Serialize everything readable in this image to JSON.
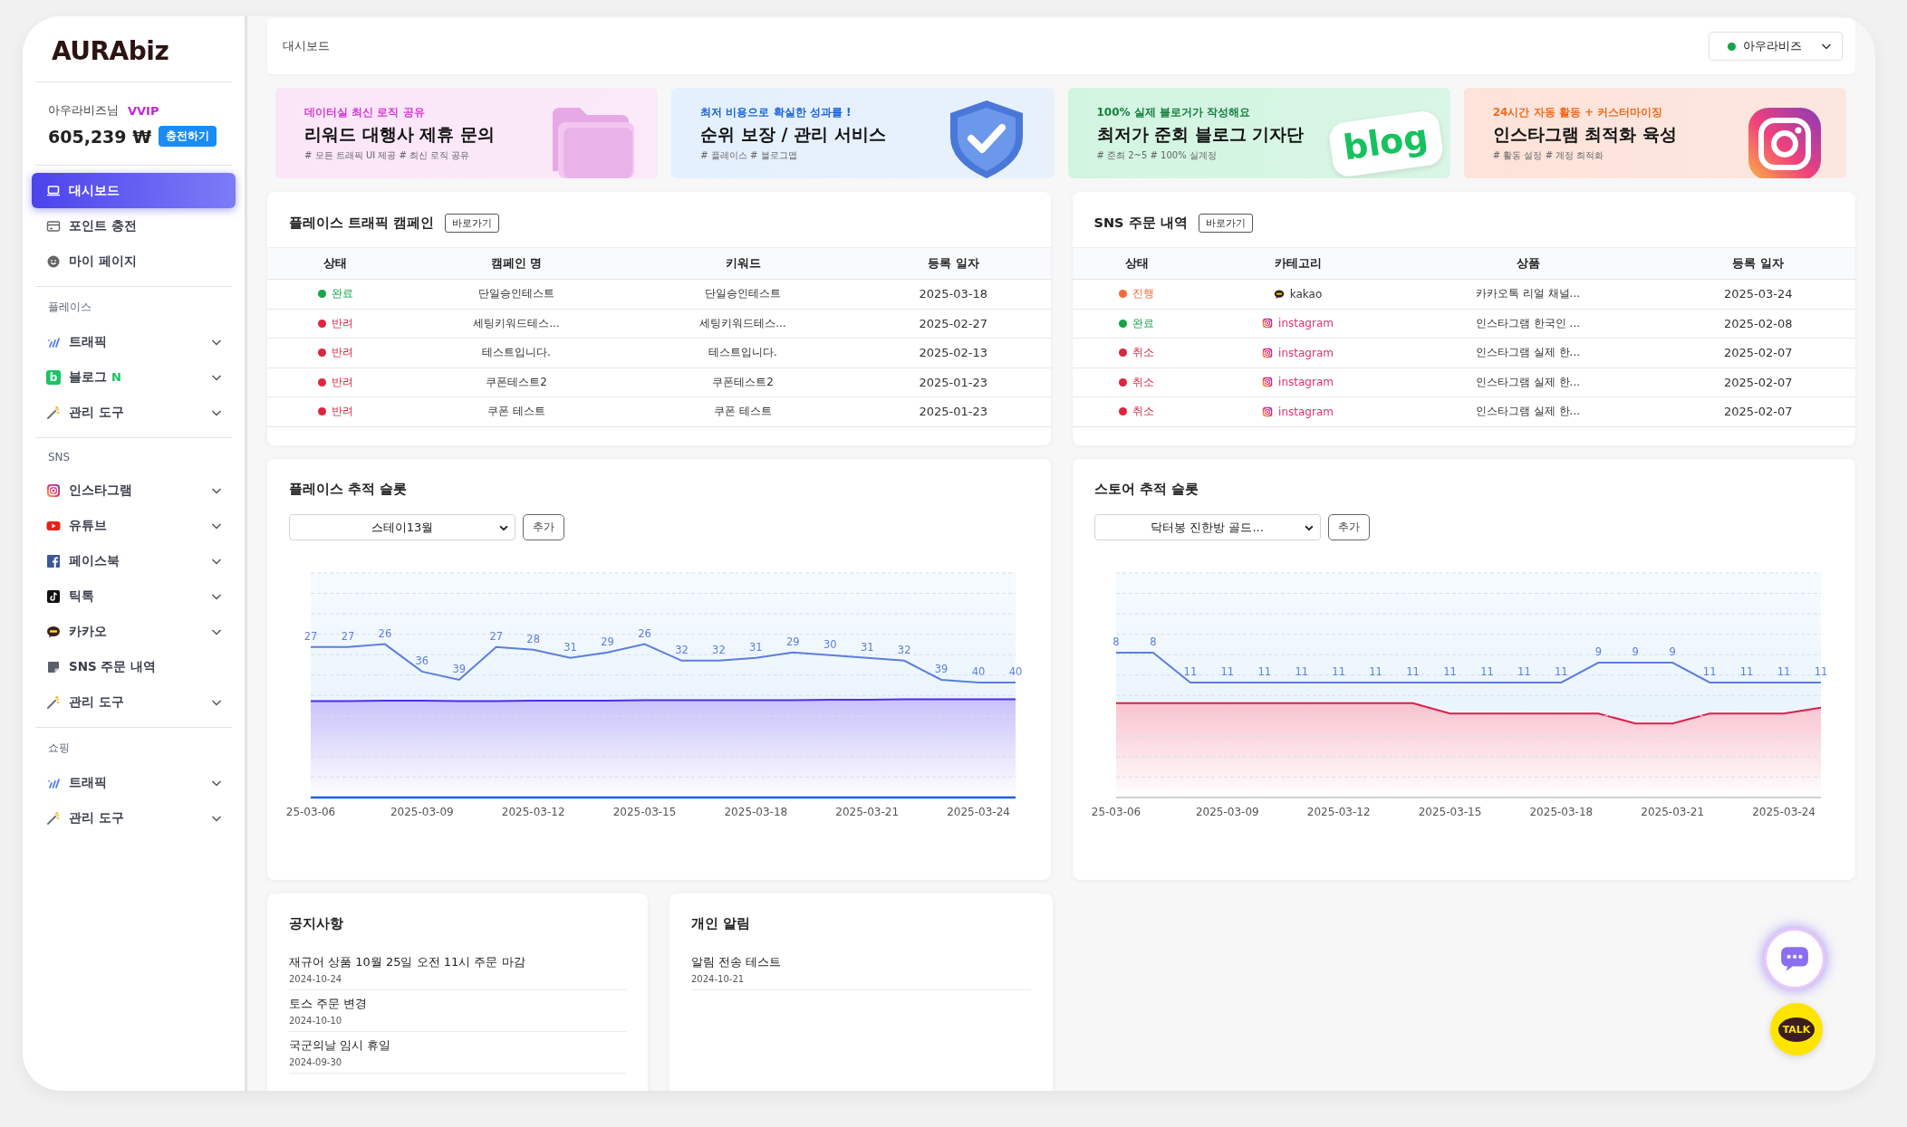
{
  "sidebar": {
    "logo": "AURAbiz",
    "user": {
      "name": "아우라비즈님",
      "tier": "VVIP",
      "balance": "605,239 ₩",
      "charge_button": "충전하기"
    },
    "main_menu": [
      {
        "kind": "dashboard",
        "label": "대시보드",
        "selected": true
      },
      {
        "kind": "card",
        "label": "포인트 충전",
        "selected": false
      },
      {
        "kind": "profile",
        "label": "마이 페이지",
        "selected": false
      }
    ],
    "sections": [
      {
        "title": "플레이스",
        "items": [
          {
            "kind": "traffic",
            "label": "트래픽",
            "selected": false
          },
          {
            "kind": "blog",
            "label": "블로그",
            "icon_letter": "b",
            "badge": "N",
            "selected": false
          },
          {
            "kind": "tools",
            "label": "관리 도구",
            "selected": false
          }
        ]
      },
      {
        "title": "SNS",
        "items": [
          {
            "kind": "instagram",
            "label": "인스타그램",
            "selected": false
          },
          {
            "kind": "youtube",
            "label": "유튜브",
            "selected": false
          },
          {
            "kind": "facebook",
            "label": "페이스북",
            "selected": false
          },
          {
            "kind": "tiktok",
            "label": "틱톡",
            "selected": false
          },
          {
            "kind": "kakao",
            "label": "카카오",
            "selected": false
          },
          {
            "kind": "orders",
            "label": "SNS 주문 내역",
            "selected": false
          },
          {
            "kind": "tools",
            "label": "관리 도구",
            "selected": false
          }
        ]
      },
      {
        "title": "쇼핑",
        "items": [
          {
            "kind": "traffic",
            "label": "트래픽",
            "selected": false
          },
          {
            "kind": "tools",
            "label": "관리 도구",
            "selected": false
          }
        ]
      }
    ]
  },
  "topbar": {
    "breadcrumb": "대시보드",
    "account": {
      "label": "아우라비즈",
      "color": "#16a34a"
    }
  },
  "banners": [
    {
      "kind": "folder",
      "color": "#fbe6f8",
      "eyebrow": "데이터실 최신 로직 공유",
      "title": "리워드 대행사 제휴 문의",
      "tags": "# 모든 트래픽 UI 제공 # 최신 로직 공유"
    },
    {
      "kind": "shield",
      "color": "#e4f0fd",
      "eyebrow": "최저 비용으로 확실한 성과를 !",
      "title": "순위 보장 / 관리 서비스",
      "tags": "# 플레이스 # 블로그맵"
    },
    {
      "kind": "blog",
      "color": "#d2f5e1",
      "eyebrow": "100% 실제 블로거가 작성해요",
      "title": "최저가 준회 블로그 기자단",
      "tags": "# 준최 2~5 # 100% 실계정",
      "art_text": "blog"
    },
    {
      "kind": "instagram",
      "color": "#fde3da",
      "eyebrow": "24시간 자동 활동 + 커스터마이징",
      "title": "인스타그램 최적화 육성",
      "tags": "# 활동 설정 # 계정 최적화"
    }
  ],
  "campaign_table": {
    "title": "플레이스 트래픽 캠페인",
    "link_button": "바로가기",
    "columns": [
      "상태",
      "캠페인 명",
      "키워드",
      "등록 일자"
    ],
    "rows": [
      {
        "status": "완료",
        "color": "#16a34a",
        "campaign": "단일승인테스트",
        "keyword": "단일승인테스트",
        "date": "2025-03-18"
      },
      {
        "status": "반려",
        "color": "#dc2640",
        "campaign": "세팅키워드테스...",
        "keyword": "세팅키워드테스...",
        "date": "2025-02-27"
      },
      {
        "status": "반려",
        "color": "#dc2640",
        "campaign": "테스트입니다.",
        "keyword": "테스트입니다.",
        "date": "2025-02-13"
      },
      {
        "status": "반려",
        "color": "#dc2640",
        "campaign": "쿠폰테스트2",
        "keyword": "쿠폰테스트2",
        "date": "2025-01-23"
      },
      {
        "status": "반려",
        "color": "#dc2640",
        "campaign": "쿠폰 테스트",
        "keyword": "쿠폰 테스트",
        "date": "2025-01-23"
      }
    ]
  },
  "sns_table": {
    "title": "SNS 주문 내역",
    "link_button": "바로가기",
    "columns": [
      "상태",
      "카테고리",
      "상품",
      "등록 일자"
    ],
    "rows": [
      {
        "status": "진행",
        "color": "#f26b3a",
        "category": {
          "kind": "kakao",
          "label": "kakao"
        },
        "product": "카카오톡 리얼 채널...",
        "date": "2025-03-24"
      },
      {
        "status": "완료",
        "color": "#16a34a",
        "category": {
          "kind": "instagram",
          "label": "instagram"
        },
        "product": "인스타그램 한국인 ...",
        "date": "2025-02-08"
      },
      {
        "status": "취소",
        "color": "#dc2640",
        "category": {
          "kind": "instagram",
          "label": "instagram"
        },
        "product": "인스타그램 실제 한...",
        "date": "2025-02-07"
      },
      {
        "status": "취소",
        "color": "#dc2640",
        "category": {
          "kind": "instagram",
          "label": "instagram"
        },
        "product": "인스타그램 실제 한...",
        "date": "2025-02-07"
      },
      {
        "status": "취소",
        "color": "#dc2640",
        "category": {
          "kind": "instagram",
          "label": "instagram"
        },
        "product": "인스타그램 실제 한...",
        "date": "2025-02-07"
      }
    ]
  },
  "trackers": [
    {
      "title": "플레이스 추적 슬롯",
      "select": "스테이13월",
      "add_button": "추가",
      "plot": {
        "date_labels": [
          "25-03-06",
          "2025-03-09",
          "2025-03-12",
          "2025-03-15",
          "2025-03-18",
          "2025-03-21",
          "2025-03-24"
        ],
        "point_labels": [
          "27",
          "27",
          "26",
          "36",
          "39",
          "27",
          "28",
          "31",
          "29",
          "26",
          "32",
          "32",
          "31",
          "29",
          "30",
          "31",
          "32",
          "39",
          "40",
          "40"
        ]
      }
    },
    {
      "title": "스토어 추적 슬롯",
      "select": "닥터봉 진한방 골드...",
      "add_button": "추가",
      "plot": {
        "date_labels": [
          "25-03-06",
          "2025-03-09",
          "2025-03-12",
          "2025-03-15",
          "2025-03-18",
          "2025-03-21",
          "2025-03-24"
        ],
        "point_labels": [
          "8",
          "8",
          "11",
          "11",
          "11",
          "11",
          "11",
          "11",
          "11",
          "11",
          "11",
          "11",
          "11",
          "9",
          "9",
          "9",
          "11",
          "11",
          "11",
          "11"
        ]
      }
    }
  ],
  "notices": {
    "title": "공지사항",
    "items": [
      {
        "title": "재규어 상품 10월 25일 오전 11시 주문 마감",
        "date": "2024-10-24"
      },
      {
        "title": "토스 주문 변경",
        "date": "2024-10-10"
      },
      {
        "title": "국군의날 임시 휴일",
        "date": "2024-09-30"
      }
    ]
  },
  "personal_alerts": {
    "title": "개인 알림",
    "items": [
      {
        "title": "알림 전송 테스트",
        "date": "2024-10-21"
      }
    ]
  },
  "floating": {
    "talk_label": "TALK"
  }
}
